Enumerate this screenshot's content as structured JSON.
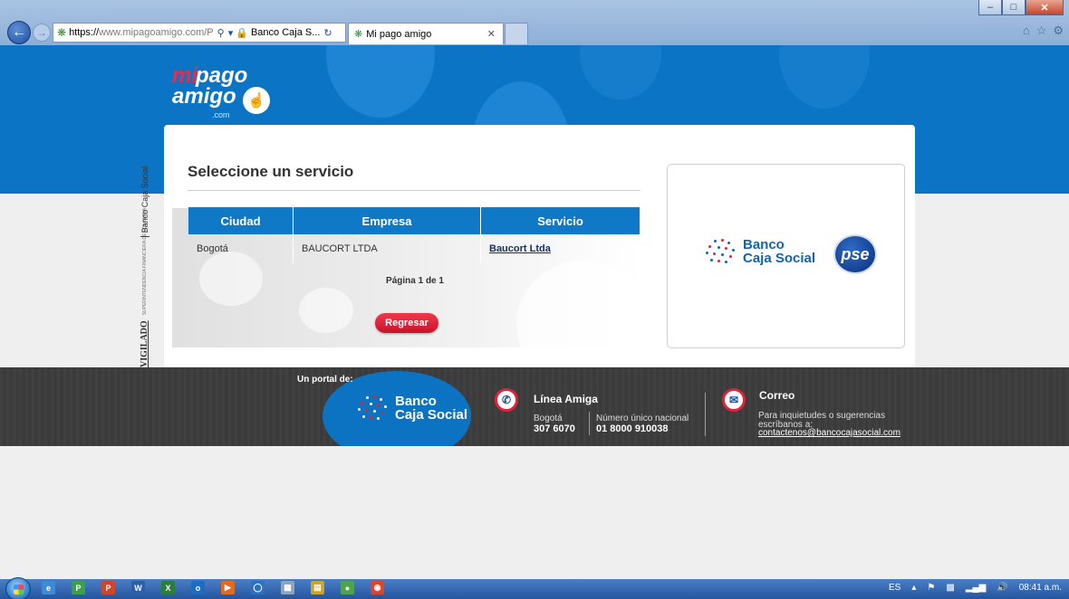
{
  "browser": {
    "url_prefix": "https://",
    "url_host": "www.mipagoamigo.com",
    "url_path": "/P",
    "site_identity": "Banco Caja S...",
    "tab_title": "Mi pago amigo"
  },
  "brand": {
    "logo_mi": "mi",
    "logo_pago": "pago",
    "logo_amigo": "amigo",
    "logo_com": ".com"
  },
  "badge": {
    "vigilado": "VIGILADO",
    "superintendencia": "SUPERINTENDENCIA FINANCIERA DE COLOMBIA",
    "bank": "Banco Caja Social"
  },
  "main": {
    "title": "Seleccione un servicio",
    "table": {
      "headers": [
        "Ciudad",
        "Empresa",
        "Servicio"
      ],
      "rows": [
        {
          "ciudad": "Bogotá",
          "empresa": "BAUCORT LTDA",
          "servicio": "Baucort Ltda"
        }
      ]
    },
    "pagination": "Página 1 de 1",
    "back_button": "Regresar"
  },
  "partners": {
    "bank_line1": "Banco",
    "bank_line2": "Caja Social",
    "pse_label": "pse"
  },
  "footer": {
    "portal_label": "Un portal de:",
    "bank_line1": "Banco",
    "bank_line2": "Caja Social",
    "linea_title": "Línea Amiga",
    "bogota_label": "Bogotá",
    "bogota_phone": "307 6070",
    "national_label": "Número único nacional",
    "national_phone": "01 8000 910038",
    "correo_title": "Correo",
    "correo_text1": "Para inquietudes o sugerencias",
    "correo_text2": "escríbanos a:",
    "correo_email": "contactenos@bancocajasocial.com"
  },
  "taskbar": {
    "language": "ES",
    "clock": "08:41 a.m."
  },
  "colors": {
    "brand_blue": "#0b74c4",
    "table_header": "#0f79c8",
    "accent_red": "#e0223d",
    "footer_bg": "#3b3b3b"
  }
}
